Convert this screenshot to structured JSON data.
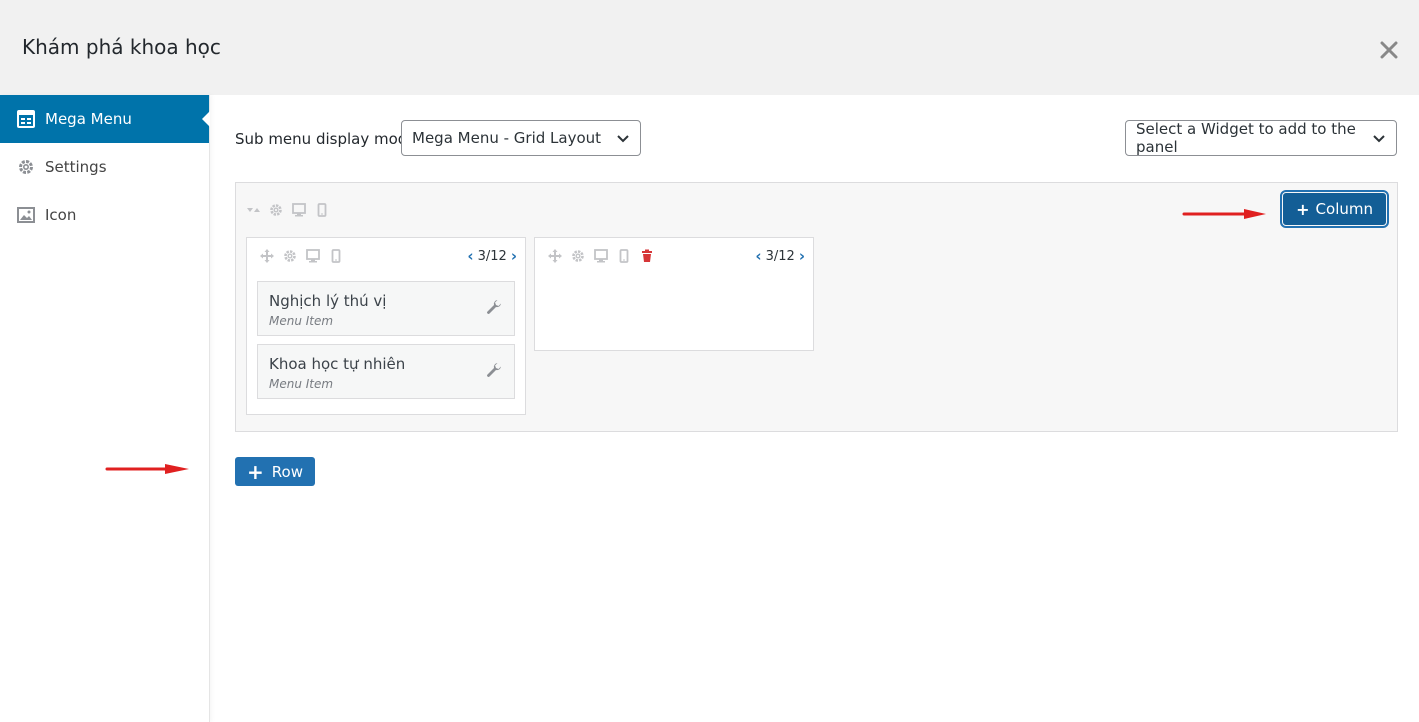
{
  "header": {
    "title": "Khám phá khoa học"
  },
  "sidebar": {
    "items": [
      {
        "label": "Mega Menu",
        "icon": "grid-icon",
        "active": true
      },
      {
        "label": "Settings",
        "icon": "gear-icon",
        "active": false
      },
      {
        "label": "Icon",
        "icon": "image-icon",
        "active": false
      }
    ]
  },
  "main": {
    "mode_label": "Sub menu display mode",
    "mode_select": {
      "value": "Mega Menu - Grid Layout"
    },
    "widget_select": {
      "value": "Select a Widget to add to the panel"
    },
    "column_button": {
      "label": "Column"
    },
    "row_button": {
      "label": "Row"
    },
    "columns": [
      {
        "size": "3/12",
        "items": [
          {
            "title": "Nghịch lý thú vị",
            "subtitle": "Menu Item"
          },
          {
            "title": "Khoa học tự nhiên",
            "subtitle": "Menu Item"
          }
        ]
      },
      {
        "size": "3/12",
        "items": []
      }
    ]
  },
  "colors": {
    "accent": "#0073aa",
    "button": "#2271b1",
    "danger": "#d63638",
    "annotation_arrow": "#e02020"
  }
}
